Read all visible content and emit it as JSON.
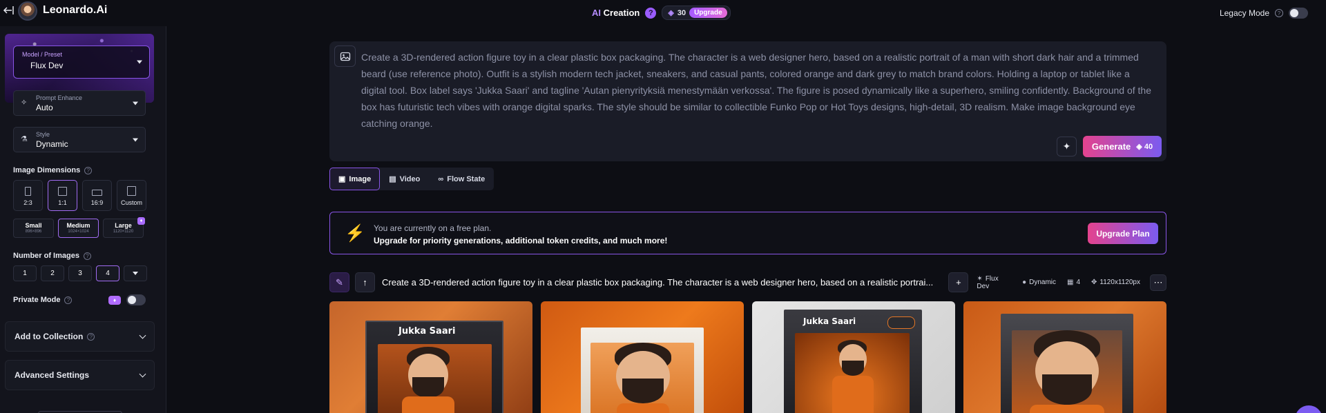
{
  "topbar": {
    "brand": "Leonardo.",
    "brand_ai": "Ai",
    "ai_prefix": "AI",
    "creation": "Creation",
    "help": "?",
    "tokens": "30",
    "upgrade": "Upgrade",
    "legacy_mode": "Legacy Mode",
    "legacy_help": "?"
  },
  "sidebar": {
    "model": {
      "label": "Model / Preset",
      "value": "Flux Dev"
    },
    "prompt_enhance": {
      "label": "Prompt Enhance",
      "value": "Auto"
    },
    "style": {
      "label": "Style",
      "value": "Dynamic"
    },
    "image_dimensions": {
      "title": "Image Dimensions",
      "help": "?",
      "ratios": [
        "2:3",
        "1:1",
        "16:9",
        "Custom"
      ],
      "selected_ratio": "1:1",
      "sizes": [
        {
          "name": "Small",
          "dims": "896×896"
        },
        {
          "name": "Medium",
          "dims": "1024×1024"
        },
        {
          "name": "Large",
          "dims": "1120×1120"
        }
      ],
      "selected_size": "Medium"
    },
    "number_of_images": {
      "title": "Number of Images",
      "help": "?",
      "options": [
        "1",
        "2",
        "3",
        "4"
      ],
      "selected": "4"
    },
    "private_mode": {
      "label": "Private Mode",
      "help": "?"
    },
    "add_to_collection": {
      "label": "Add to Collection",
      "help": "?"
    },
    "advanced_settings": {
      "label": "Advanced Settings"
    }
  },
  "prompt": {
    "text": "Create a 3D-rendered action figure toy in a clear plastic box packaging. The character is a web designer hero, based on a realistic portrait of a man with short dark hair and a trimmed beard (use reference photo). Outfit is a stylish modern tech jacket, sneakers, and casual pants, colored orange and dark grey to match brand colors. Holding a laptop or tablet like a digital tool. Box label says 'Jukka Saari' and tagline 'Autan pienyrityksiä menestymään verkossa'. The figure is posed dynamically like a superhero, smiling confidently. Background of the box has futuristic tech vibes with orange digital sparks. The style should be similar to collectible Funko Pop or Hot Toys designs, high-detail, 3D realism. Make image background eye catching orange.",
    "generate_label": "Generate",
    "generate_cost": "40"
  },
  "tabs": [
    {
      "label": "Image",
      "active": true
    },
    {
      "label": "Video",
      "active": false
    },
    {
      "label": "Flow State",
      "active": false
    }
  ],
  "banner": {
    "line1": "You are currently on a free plan.",
    "line2": "Upgrade for priority generations, additional token credits, and much more!",
    "button": "Upgrade Plan"
  },
  "generation": {
    "prompt": "Create a 3D-rendered action figure toy in a clear plastic box packaging. The character is a web designer hero, based on a realistic portrai...",
    "model": "Flux Dev",
    "style": "Dynamic",
    "count": "4",
    "size": "1120x1120px",
    "box_labels": [
      "Jukka Saari",
      "",
      "Jukka Saari",
      ""
    ]
  },
  "colors": {
    "accent_purple": "#8a55e8",
    "gradient_start": "#e4438e",
    "gradient_end": "#7b5bf0",
    "bolt_orange": "#ff9a1f"
  }
}
